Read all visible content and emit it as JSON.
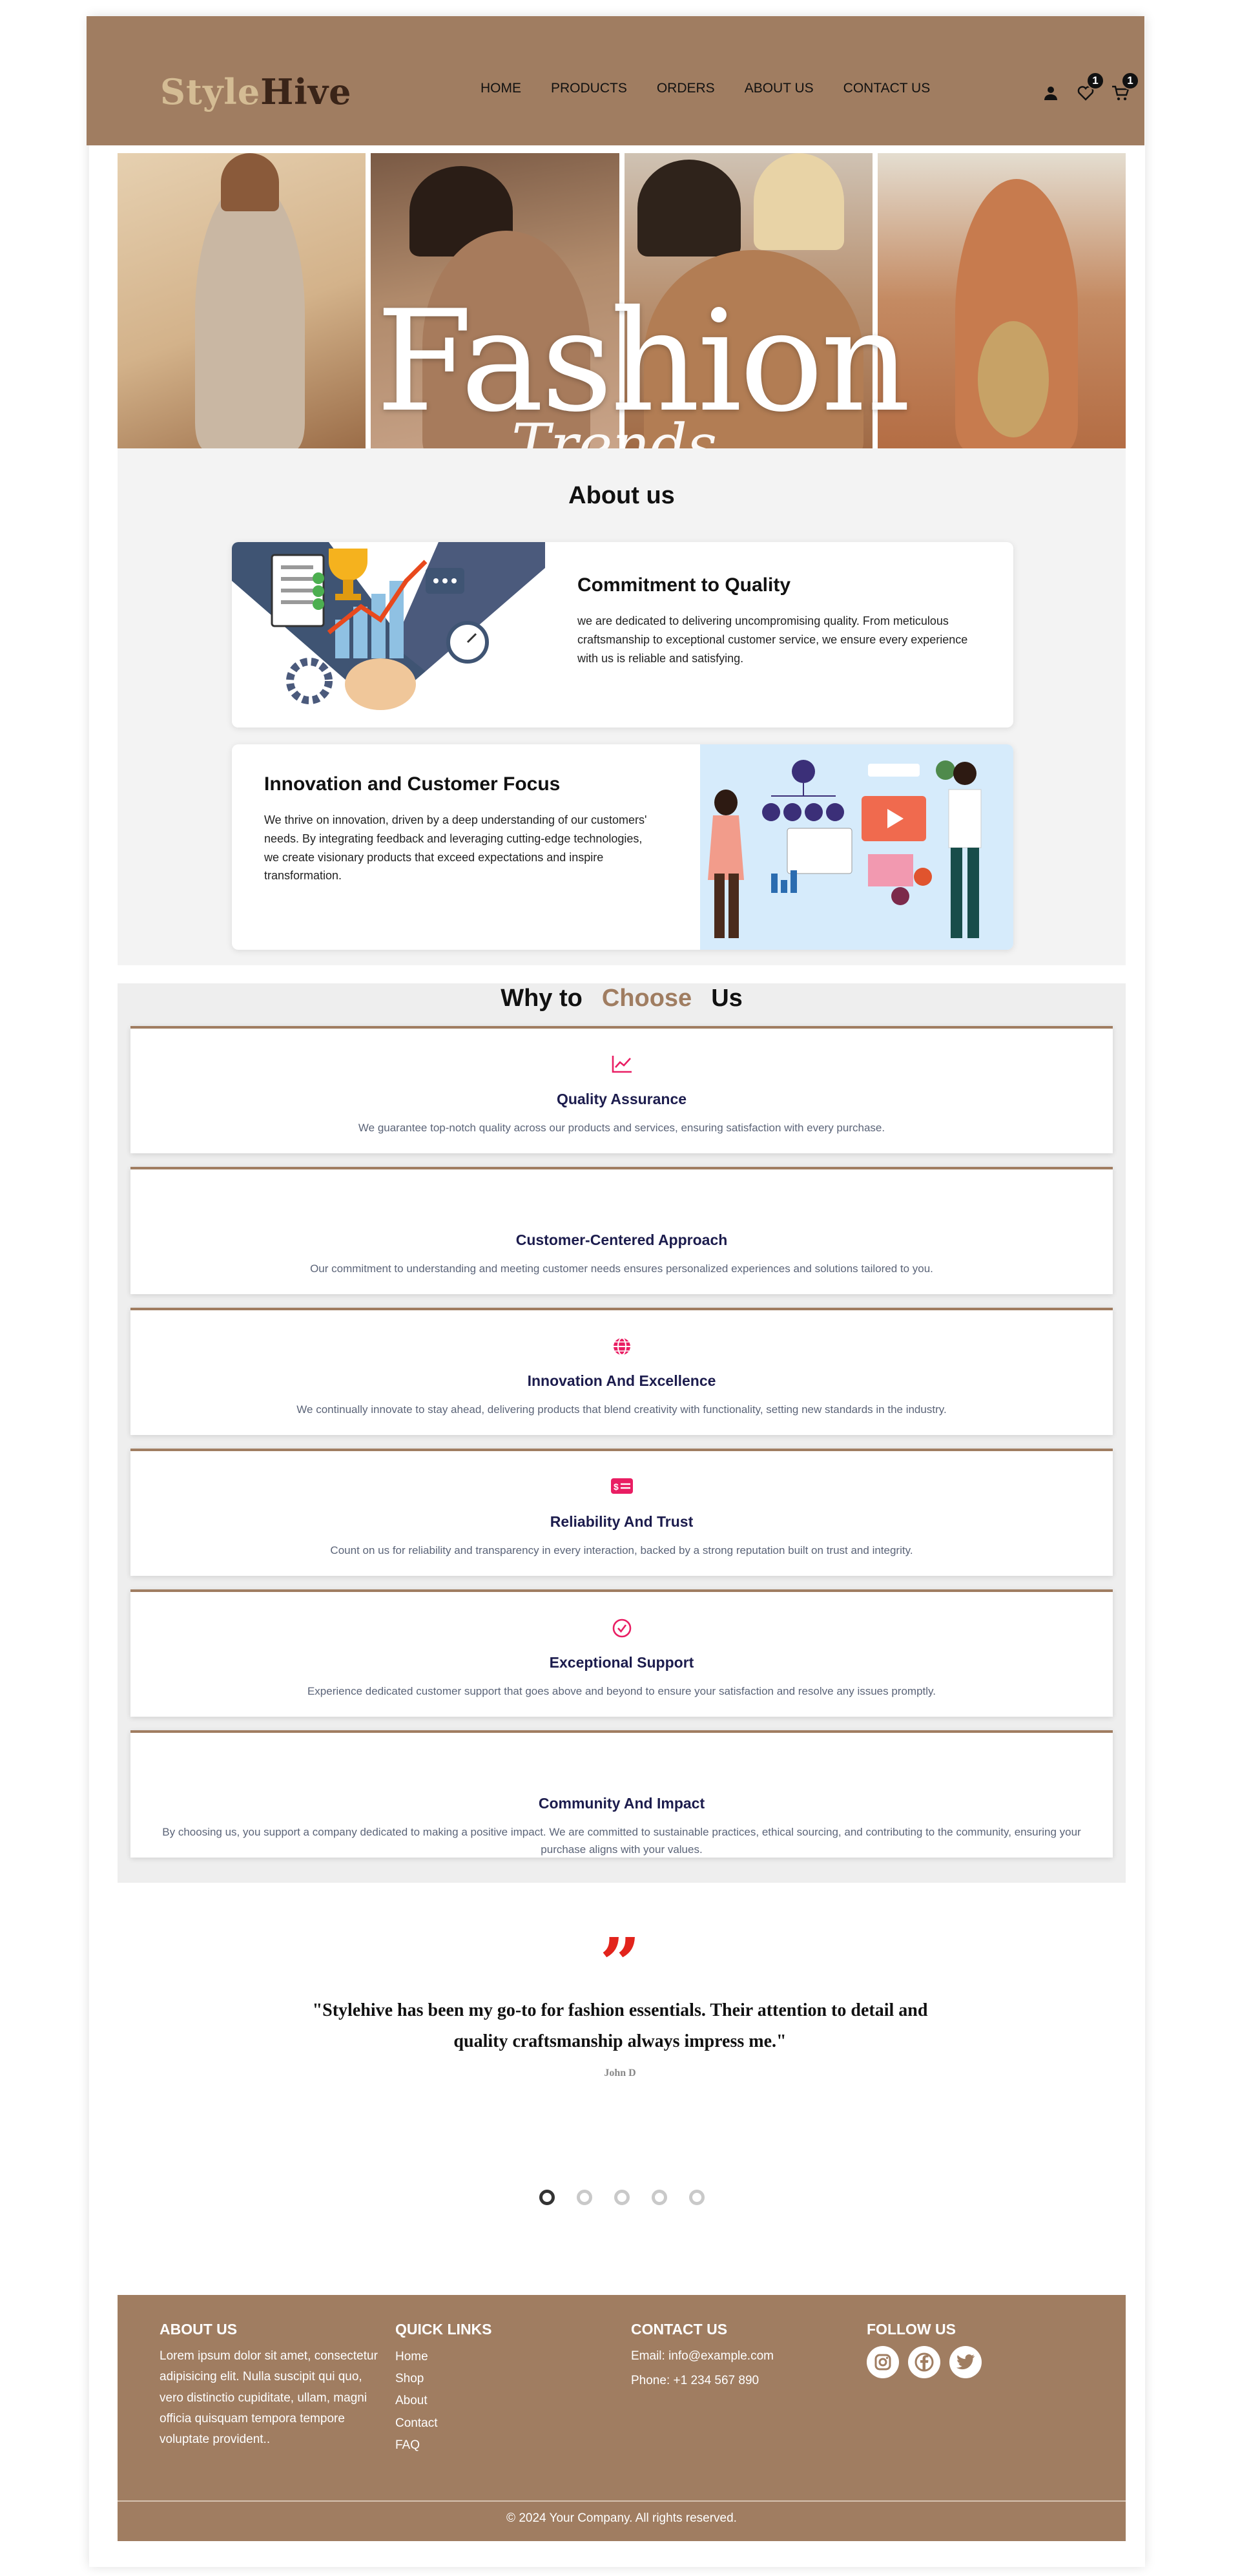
{
  "brand": {
    "part1": "Style",
    "part2": "Hive"
  },
  "nav": [
    "HOME",
    "PRODUCTS",
    "ORDERS",
    "ABOUT US",
    "CONTACT US"
  ],
  "header_icons": {
    "wishlist_count": "1",
    "cart_count": "1"
  },
  "hero": {
    "word": "Fashion",
    "script": "Trends"
  },
  "about": {
    "title": "About us",
    "cards": [
      {
        "title": "Commitment to Quality",
        "text": "we are dedicated to delivering uncompromising quality. From meticulous craftsmanship to exceptional customer service, we ensure every experience with us is reliable and satisfying."
      },
      {
        "title": "Innovation and Customer Focus",
        "text": "We thrive on innovation, driven by a deep understanding of our customers' needs. By integrating feedback and leveraging cutting-edge technologies, we create visionary products that exceed expectations and inspire transformation."
      }
    ]
  },
  "why": {
    "title_a": "Why to",
    "title_b": "Choose",
    "title_c": "Us",
    "features": [
      {
        "icon": "chart-line-icon",
        "title": "Quality Assurance",
        "text": "We guarantee top-notch quality across our products and services, ensuring satisfaction with every purchase."
      },
      {
        "icon": "",
        "title": "Customer-Centered Approach",
        "text": "Our commitment to understanding and meeting customer needs ensures personalized experiences and solutions tailored to you."
      },
      {
        "icon": "globe-icon",
        "title": "Innovation And Excellence",
        "text": "We continually innovate to stay ahead, delivering products that blend creativity with functionality, setting new standards in the industry."
      },
      {
        "icon": "dollar-card-icon",
        "title": "Reliability And Trust",
        "text": "Count on us for reliability and transparency in every interaction, backed by a strong reputation built on trust and integrity."
      },
      {
        "icon": "check-circle-icon",
        "title": "Exceptional Support",
        "text": "Experience dedicated customer support that goes above and beyond to ensure your satisfaction and resolve any issues promptly."
      },
      {
        "icon": "",
        "title": "Community And Impact",
        "text": "By choosing us, you support a company dedicated to making a positive impact. We are committed to sustainable practices, ethical sourcing, and contributing to the community, ensuring your purchase aligns with your values."
      }
    ]
  },
  "testimonial": {
    "mark": "”",
    "quote": "\"Stylehive has been my go-to for fashion essentials. Their attention to detail and quality craftsmanship always impress me.\"",
    "author": "John D",
    "slide_count": 5,
    "active_slide": 1
  },
  "footer": {
    "about_title": "ABOUT US",
    "about_text": "Lorem ipsum dolor sit amet, consectetur adipisicing elit. Nulla suscipit qui quo, vero distinctio cupiditate, ullam, magni officia quisquam tempora tempore voluptate provident..",
    "links_title": "QUICK LINKS",
    "links": [
      "Home",
      "Shop",
      "About",
      "Contact",
      "FAQ"
    ],
    "contact_title": "CONTACT US",
    "email": "Email: info@example.com",
    "phone": "Phone: +1 234 567 890",
    "follow_title": "FOLLOW US",
    "social": [
      "instagram-icon",
      "facebook-icon",
      "twitter-icon"
    ],
    "copyright": "© 2024 Your Company. All rights reserved."
  },
  "colors": {
    "brand_brown": "#a07d61",
    "accent_pink": "#e91e63",
    "quote_red": "#e2241c",
    "heading_navy": "#1c1c4d"
  }
}
